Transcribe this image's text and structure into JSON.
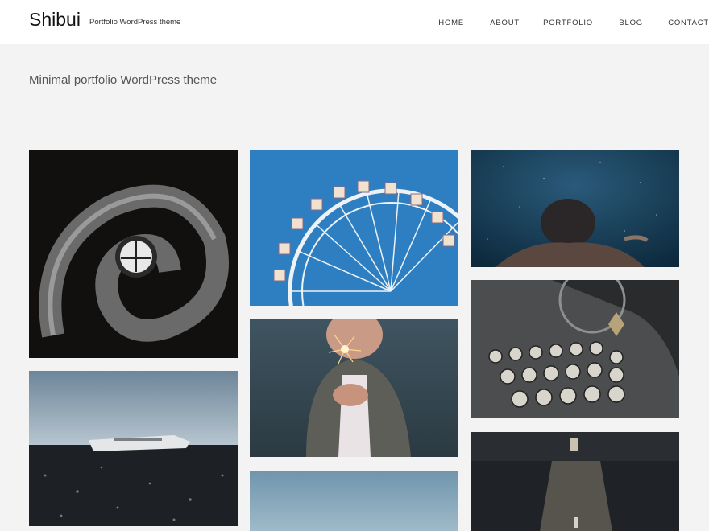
{
  "header": {
    "site_title": "Shibui",
    "tagline": "Portfolio WordPress theme",
    "nav": [
      {
        "label": "HOME"
      },
      {
        "label": "ABOUT"
      },
      {
        "label": "PORTFOLIO"
      },
      {
        "label": "BLOG"
      },
      {
        "label": "CONTACT"
      }
    ]
  },
  "hero": {
    "text": "Minimal portfolio WordPress theme"
  },
  "colors": {
    "header_bg": "#ffffff",
    "page_bg": "#f3f3f3"
  }
}
